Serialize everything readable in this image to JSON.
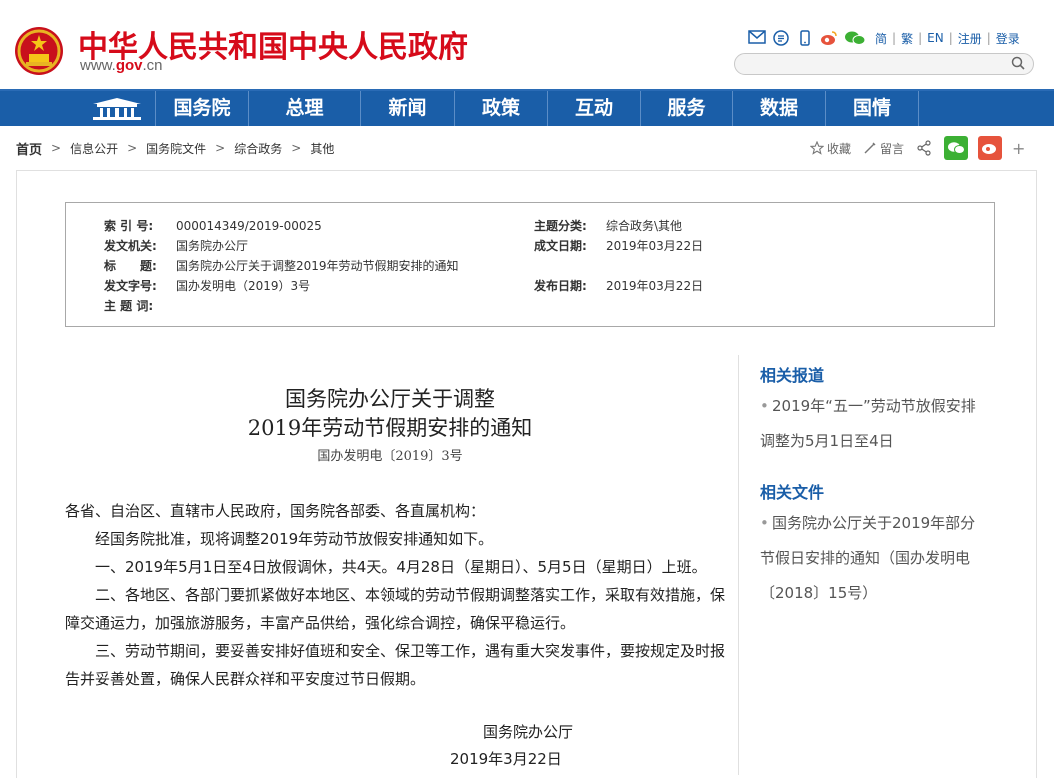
{
  "header": {
    "site_title": "中华人民共和国中央人民政府",
    "url_prefix": "www.",
    "url_gov": "gov",
    "url_suffix": ".cn",
    "links": [
      "简",
      "繁",
      "EN",
      "注册",
      "登录"
    ],
    "search_placeholder": ""
  },
  "nav": {
    "items": [
      "国务院",
      "总理",
      "新闻",
      "政策",
      "互动",
      "服务",
      "数据",
      "国情"
    ]
  },
  "breadcrumb": [
    "首页",
    "信息公开",
    "国务院文件",
    "综合政务",
    "其他"
  ],
  "share": {
    "collect": "收藏",
    "comment": "留言",
    "plus": "+"
  },
  "meta": {
    "index_label": "索 引 号:",
    "index_value": "000014349/2019-00025",
    "issuer_label": "发文机关:",
    "issuer_value": "国务院办公厅",
    "title_label": "标　　题:",
    "title_value": "国务院办公厅关于调整2019年劳动节假期安排的通知",
    "docno_label": "发文字号:",
    "docno_value": "国办发明电（2019）3号",
    "keywords_label": "主 题 词:",
    "keywords_value": "",
    "category_label": "主题分类:",
    "category_value": "综合政务\\其他",
    "written_label": "成文日期:",
    "written_value": "2019年03月22日",
    "published_label": "发布日期:",
    "published_value": "2019年03月22日"
  },
  "article": {
    "title_line1": "国务院办公厅关于调整",
    "title_line2": "2019年劳动节假期安排的通知",
    "doc_number": "国办发明电〔2019〕3号",
    "salutation": "各省、自治区、直辖市人民政府，国务院各部委、各直属机构：",
    "para1": "经国务院批准，现将调整2019年劳动节放假安排通知如下。",
    "para2": "一、2019年5月1日至4日放假调休，共4天。4月28日（星期日）、5月5日（星期日）上班。",
    "para3": "二、各地区、各部门要抓紧做好本地区、本领域的劳动节假期调整落实工作，采取有效措施，保障交通运力，加强旅游服务，丰富产品供给，强化综合调控，确保平稳运行。",
    "para4": "三、劳动节期间，要妥善安排好值班和安全、保卫等工作，遇有重大突发事件，要按规定及时报告并妥善处置，确保人民群众祥和平安度过节日假期。",
    "signer": "国务院办公厅",
    "sign_date": "2019年3月22日"
  },
  "sidebar": {
    "related_reports_heading": "相关报道",
    "related_reports": [
      "2019年“五一”劳动节放假安排调整为5月1日至4日"
    ],
    "related_files_heading": "相关文件",
    "related_files": [
      "国务院办公厅关于2019年部分节假日安排的通知（国办发明电〔2018〕15号）"
    ]
  },
  "colors": {
    "brand_red": "#d60b1a",
    "nav_blue": "#1a5ea8",
    "wechat_green": "#3cb034",
    "weibo_red": "#e6533c"
  }
}
